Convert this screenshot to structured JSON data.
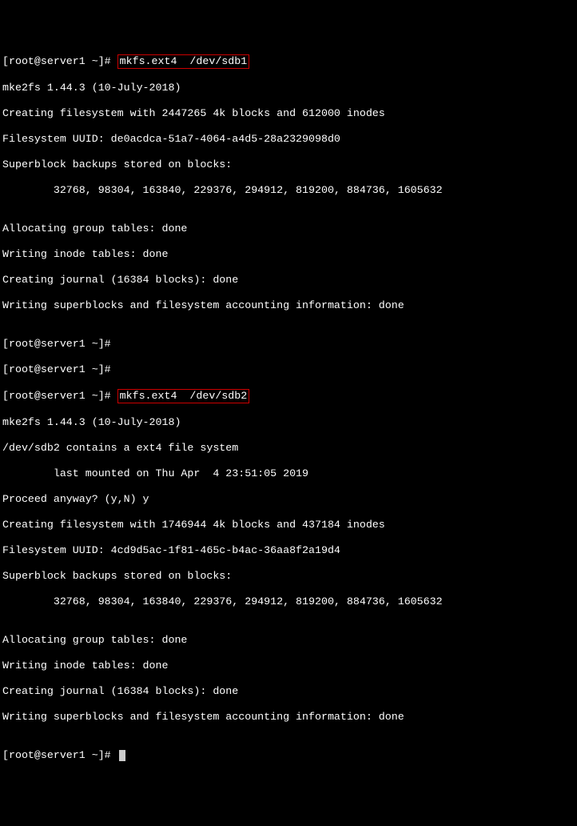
{
  "prompt": "[root@server1 ~]# ",
  "cmd1": "mkfs.ext4  /dev/sdb1",
  "cmd2": "mkfs.ext4  /dev/sdb2",
  "out1": {
    "l1": "mke2fs 1.44.3 (10-July-2018)",
    "l2": "Creating filesystem with 2447265 4k blocks and 612000 inodes",
    "l3": "Filesystem UUID: de0acdca-51a7-4064-a4d5-28a2329098d0",
    "l4": "Superblock backups stored on blocks:",
    "l5": "        32768, 98304, 163840, 229376, 294912, 819200, 884736, 1605632",
    "l6": "",
    "l7": "Allocating group tables: done",
    "l8": "Writing inode tables: done",
    "l9": "Creating journal (16384 blocks): done",
    "l10": "Writing superblocks and filesystem accounting information: done",
    "l11": ""
  },
  "out2": {
    "l1": "mke2fs 1.44.3 (10-July-2018)",
    "l2": "/dev/sdb2 contains a ext4 file system",
    "l3": "        last mounted on Thu Apr  4 23:51:05 2019",
    "l4": "Proceed anyway? (y,N) y",
    "l5": "Creating filesystem with 1746944 4k blocks and 437184 inodes",
    "l6": "Filesystem UUID: 4cd9d5ac-1f81-465c-b4ac-36aa8f2a19d4",
    "l7": "Superblock backups stored on blocks:",
    "l8": "        32768, 98304, 163840, 229376, 294912, 819200, 884736, 1605632",
    "l9": "",
    "l10": "Allocating group tables: done",
    "l11": "Writing inode tables: done",
    "l12": "Creating journal (16384 blocks): done",
    "l13": "Writing superblocks and filesystem accounting information: done",
    "l14": ""
  }
}
